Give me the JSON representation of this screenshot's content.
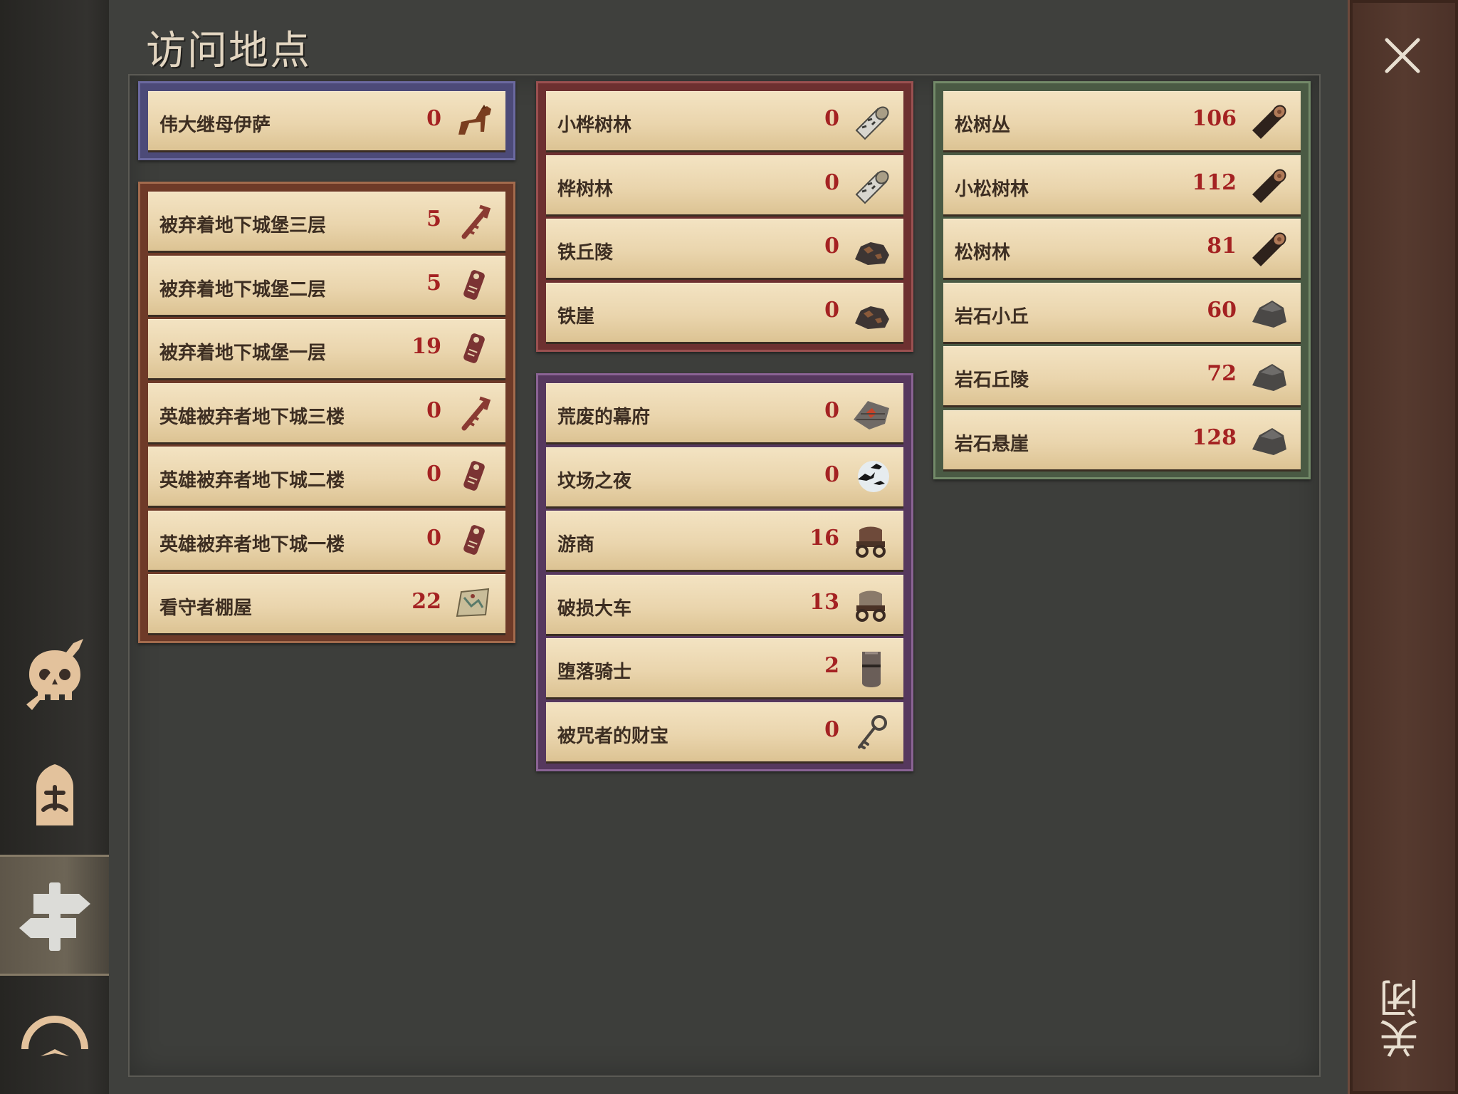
{
  "title": "访问地点",
  "close_label": "关闭",
  "sidebar": {
    "tabs": [
      {
        "icon": "skull-dagger-icon"
      },
      {
        "icon": "helmet-icon"
      },
      {
        "icon": "signpost-icon",
        "active": true
      },
      {
        "icon": "moon-bird-icon"
      }
    ]
  },
  "groups": [
    {
      "color": "purple",
      "items": [
        {
          "name": "伟大继母伊萨",
          "count": "0",
          "icon": "horse-icon"
        }
      ]
    },
    {
      "color": "rust",
      "items": [
        {
          "name": "被弃着地下城堡三层",
          "count": "5",
          "icon": "key-map-icon"
        },
        {
          "name": "被弃着地下城堡二层",
          "count": "5",
          "icon": "tag-map-icon"
        },
        {
          "name": "被弃着地下城堡一层",
          "count": "19",
          "icon": "tag-map-icon"
        },
        {
          "name": "英雄被弃者地下城三楼",
          "count": "0",
          "icon": "key-map-icon"
        },
        {
          "name": "英雄被弃者地下城二楼",
          "count": "0",
          "icon": "tag-map-icon"
        },
        {
          "name": "英雄被弃者地下城一楼",
          "count": "0",
          "icon": "tag-map-icon"
        },
        {
          "name": "看守者棚屋",
          "count": "22",
          "icon": "scroll-map-icon"
        }
      ]
    },
    {
      "color": "red",
      "items": [
        {
          "name": "小桦树林",
          "count": "0",
          "icon": "birch-log-icon"
        },
        {
          "name": "桦树林",
          "count": "0",
          "icon": "birch-log-icon"
        },
        {
          "name": "铁丘陵",
          "count": "0",
          "icon": "iron-ore-icon"
        },
        {
          "name": "铁崖",
          "count": "0",
          "icon": "iron-ore-icon"
        }
      ]
    },
    {
      "color": "violet",
      "items": [
        {
          "name": "荒废的幕府",
          "count": "0",
          "icon": "ruins-icon"
        },
        {
          "name": "坟场之夜",
          "count": "0",
          "icon": "crows-moon-icon"
        },
        {
          "name": "游商",
          "count": "16",
          "icon": "wagon-icon"
        },
        {
          "name": "破损大车",
          "count": "13",
          "icon": "wagon-icon"
        },
        {
          "name": "堕落骑士",
          "count": "2",
          "icon": "knight-helmet-icon"
        },
        {
          "name": "被咒者的财宝",
          "count": "0",
          "icon": "key-icon"
        }
      ]
    },
    {
      "color": "green",
      "items": [
        {
          "name": "松树丛",
          "count": "106",
          "icon": "pine-log-icon"
        },
        {
          "name": "小松树林",
          "count": "112",
          "icon": "pine-log-icon"
        },
        {
          "name": "松树林",
          "count": "81",
          "icon": "pine-log-icon"
        },
        {
          "name": "岩石小丘",
          "count": "60",
          "icon": "stone-icon"
        },
        {
          "name": "岩石丘陵",
          "count": "72",
          "icon": "stone-icon"
        },
        {
          "name": "岩石悬崖",
          "count": "128",
          "icon": "stone-icon"
        }
      ]
    }
  ]
}
